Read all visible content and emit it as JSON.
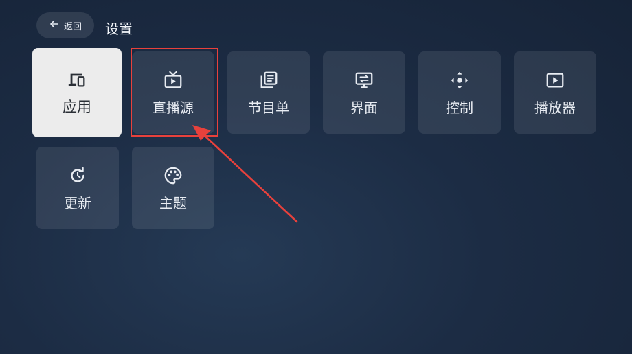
{
  "header": {
    "back_label": "返回",
    "title": "设置"
  },
  "tiles": [
    {
      "label": "应用",
      "icon": "devices-icon",
      "selected": true
    },
    {
      "label": "直播源",
      "icon": "tv-icon",
      "selected": false
    },
    {
      "label": "节目单",
      "icon": "library-list-icon",
      "selected": false
    },
    {
      "label": "界面",
      "icon": "display-swap-icon",
      "selected": false
    },
    {
      "label": "控制",
      "icon": "dpad-icon",
      "selected": false
    },
    {
      "label": "播放器",
      "icon": "play-box-icon",
      "selected": false
    },
    {
      "label": "更新",
      "icon": "update-icon",
      "selected": false
    },
    {
      "label": "主题",
      "icon": "palette-icon",
      "selected": false
    }
  ],
  "colors": {
    "annotation": "#e8413c",
    "selected_tile": "#ececec",
    "background": "#1c2c44"
  }
}
